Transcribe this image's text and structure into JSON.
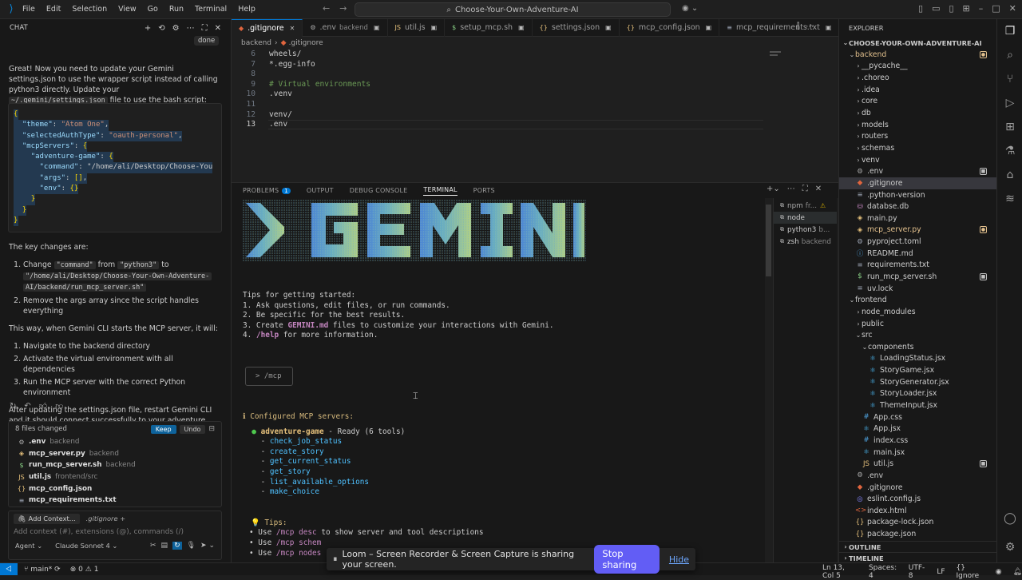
{
  "titlebar": {
    "menu": [
      "File",
      "Edit",
      "Selection",
      "View",
      "Go",
      "Run",
      "Terminal",
      "Help"
    ],
    "search": "Choose-Your-Own-Adventure-AI"
  },
  "chat": {
    "title": "CHAT",
    "done_label": "done",
    "intro": "Great! Now you need to update your Gemini settings.json to use the wrapper script instead of calling python3 directly. Update your",
    "intro_code": "~/.gemini/settings.json",
    "intro_end": " file to use the bash script:",
    "json_lines": [
      "{",
      "  \"theme\": \"Atom One\",",
      "  \"selectedAuthType\": \"oauth-personal\",",
      "  \"mcpServers\": {",
      "    \"adventure-game\": {",
      "      \"command\": \"/home/ali/Desktop/Choose-You",
      "      \"args\": [],",
      "      \"env\": {}",
      "    }",
      "  }",
      "}"
    ],
    "key_changes": "The key changes are:",
    "change1_a": "Change ",
    "change1_code1": "\"command\"",
    "change1_b": " from ",
    "change1_code2": "\"python3\"",
    "change1_c": " to",
    "change1_code3": "\"/home/ali/Desktop/Choose-Your-Own-Adventure-",
    "change1_code4": "AI/backend/run_mcp_server.sh\"",
    "change2": "Remove the args array since the script handles everything",
    "way": "This way, when Gemini CLI starts the MCP server, it will:",
    "steps": [
      "Navigate to the backend directory",
      "Activate the virtual environment with all dependencies",
      "Run the MCP server with the correct Python environment"
    ],
    "after": "After updating the settings.json file, restart Gemini CLI and it should connect successfully to your adventure game MCP server!",
    "files_changed": "8 files changed",
    "keep": "Keep",
    "undo": "Undo",
    "files": [
      {
        "icon": "gear",
        "name": ".env",
        "dir": "backend"
      },
      {
        "icon": "py",
        "name": "mcp_server.py",
        "dir": "backend"
      },
      {
        "icon": "$",
        "name": "run_mcp_server.sh",
        "dir": "backend"
      },
      {
        "icon": "JS",
        "name": "util.js",
        "dir": "frontend/src"
      },
      {
        "icon": "{}",
        "name": "mcp_config.json",
        "dir": ""
      },
      {
        "icon": "txt",
        "name": "mcp_requirements.txt",
        "dir": ""
      }
    ],
    "add_context": "Add Context...",
    "context_file": ".gitignore",
    "input_placeholder": "Add context (#), extensions (@), commands (/)",
    "mode": "Agent",
    "model": "Claude Sonnet 4"
  },
  "tabs": [
    {
      "label": ".gitignore",
      "dir": "",
      "active": true,
      "icon": "git"
    },
    {
      "label": ".env",
      "dir": "backend",
      "active": false,
      "icon": "gear"
    },
    {
      "label": "util.js",
      "dir": "",
      "active": false,
      "icon": "JS"
    },
    {
      "label": "setup_mcp.sh",
      "dir": "",
      "active": false,
      "icon": "$"
    },
    {
      "label": "settings.json",
      "dir": "",
      "active": false,
      "icon": "{}"
    },
    {
      "label": "mcp_config.json",
      "dir": "",
      "active": false,
      "icon": "{}"
    },
    {
      "label": "mcp_requirements.txt",
      "dir": "",
      "active": false,
      "icon": "txt"
    }
  ],
  "breadcrumb": [
    "backend",
    ".gitignore"
  ],
  "code": [
    {
      "n": "6",
      "text": "wheels/",
      "cls": "plain"
    },
    {
      "n": "7",
      "text": "*.egg-info",
      "cls": "plain"
    },
    {
      "n": "8",
      "text": "",
      "cls": "plain"
    },
    {
      "n": "9",
      "text": "# Virtual environments",
      "cls": "comment"
    },
    {
      "n": "10",
      "text": ".venv",
      "cls": "plain"
    },
    {
      "n": "11",
      "text": "",
      "cls": "plain"
    },
    {
      "n": "12",
      "text": "venv/",
      "cls": "plain"
    },
    {
      "n": "13",
      "text": ".env",
      "cls": "plain"
    }
  ],
  "panel_tabs": [
    {
      "label": "PROBLEMS",
      "badge": "1"
    },
    {
      "label": "OUTPUT",
      "badge": ""
    },
    {
      "label": "DEBUG CONSOLE",
      "badge": ""
    },
    {
      "label": "TERMINAL",
      "badge": "",
      "active": true
    },
    {
      "label": "PORTS",
      "badge": ""
    }
  ],
  "terminal": {
    "banner": "GEMINI",
    "tips_header": "Tips for getting started:",
    "tips": [
      "1. Ask questions, edit files, or run commands.",
      "2. Be specific for the best results."
    ],
    "tip3_a": "3. Create ",
    "tip3_b": "GEMINI.md",
    "tip3_c": " files to customize your interactions with Gemini.",
    "tip4_a": "4. ",
    "tip4_b": "/help",
    "tip4_c": " for more information.",
    "prompt": "> /mcp",
    "configured": "ℹ Configured MCP servers:",
    "server_name": "adventure-game",
    "server_status": " - Ready (6 tools)",
    "tools": [
      "check_job_status",
      "create_story",
      "get_current_status",
      "get_story",
      "list_available_options",
      "make_choice"
    ],
    "tips2_header": "💡 Tips:",
    "tips2": [
      {
        "a": "• Use ",
        "b": "/mcp desc",
        "c": " to show server and tool descriptions"
      },
      {
        "a": "• Use ",
        "b": "/mcp schem",
        "c": ""
      },
      {
        "a": "• Use ",
        "b": "/mcp nodes",
        "c": ""
      }
    ]
  },
  "terminal_list": [
    {
      "icon": ">_",
      "name": "npm",
      "extra": "fr...",
      "warn": true
    },
    {
      "icon": ">_",
      "name": "node",
      "extra": "",
      "active": true
    },
    {
      "icon": ">_",
      "name": "python3",
      "extra": "b..."
    },
    {
      "icon": ">_",
      "name": "zsh",
      "extra": "backend"
    }
  ],
  "explorer": {
    "title": "EXPLORER",
    "root": "CHOOSE-YOUR-OWN-ADVENTURE-AI",
    "items": [
      {
        "depth": 1,
        "type": "folder-open",
        "name": "backend",
        "color": "#e2c08d",
        "badge": "dot"
      },
      {
        "depth": 2,
        "type": "folder",
        "name": "__pycache__"
      },
      {
        "depth": 2,
        "type": "folder",
        "name": ".choreo"
      },
      {
        "depth": 2,
        "type": "folder",
        "name": ".idea"
      },
      {
        "depth": 2,
        "type": "folder",
        "name": "core"
      },
      {
        "depth": 2,
        "type": "folder",
        "name": "db"
      },
      {
        "depth": 2,
        "type": "folder",
        "name": "models"
      },
      {
        "depth": 2,
        "type": "folder",
        "name": "routers"
      },
      {
        "depth": 2,
        "type": "folder",
        "name": "schemas"
      },
      {
        "depth": 2,
        "type": "folder",
        "name": "venv"
      },
      {
        "depth": 2,
        "type": "gear",
        "name": ".env",
        "badge": "M"
      },
      {
        "depth": 2,
        "type": "git",
        "name": ".gitignore",
        "selected": true
      },
      {
        "depth": 2,
        "type": "file",
        "name": ".python-version"
      },
      {
        "depth": 2,
        "type": "db",
        "name": "databse.db"
      },
      {
        "depth": 2,
        "type": "py",
        "name": "main.py"
      },
      {
        "depth": 2,
        "type": "py",
        "name": "mcp_server.py",
        "color": "#e2c08d",
        "badge": "dot"
      },
      {
        "depth": 2,
        "type": "toml",
        "name": "pyproject.toml"
      },
      {
        "depth": 2,
        "type": "info",
        "name": "README.md"
      },
      {
        "depth": 2,
        "type": "txt",
        "name": "requirements.txt"
      },
      {
        "depth": 2,
        "type": "sh",
        "name": "run_mcp_server.sh",
        "badge": "M"
      },
      {
        "depth": 2,
        "type": "file",
        "name": "uv.lock"
      },
      {
        "depth": 1,
        "type": "folder-open",
        "name": "frontend"
      },
      {
        "depth": 2,
        "type": "folder",
        "name": "node_modules"
      },
      {
        "depth": 2,
        "type": "folder",
        "name": "public"
      },
      {
        "depth": 2,
        "type": "folder-open",
        "name": "src"
      },
      {
        "depth": 3,
        "type": "folder-open",
        "name": "components"
      },
      {
        "depth": 4,
        "type": "jsx",
        "name": "LoadingStatus.jsx"
      },
      {
        "depth": 4,
        "type": "jsx",
        "name": "StoryGame.jsx"
      },
      {
        "depth": 4,
        "type": "jsx",
        "name": "StoryGenerator.jsx"
      },
      {
        "depth": 4,
        "type": "jsx",
        "name": "StoryLoader.jsx"
      },
      {
        "depth": 4,
        "type": "jsx",
        "name": "ThemeInput.jsx"
      },
      {
        "depth": 3,
        "type": "css",
        "name": "App.css"
      },
      {
        "depth": 3,
        "type": "jsx",
        "name": "App.jsx"
      },
      {
        "depth": 3,
        "type": "css",
        "name": "index.css"
      },
      {
        "depth": 3,
        "type": "jsx",
        "name": "main.jsx"
      },
      {
        "depth": 3,
        "type": "js",
        "name": "util.js",
        "badge": "M"
      },
      {
        "depth": 2,
        "type": "gear",
        "name": ".env"
      },
      {
        "depth": 2,
        "type": "git",
        "name": ".gitignore"
      },
      {
        "depth": 2,
        "type": "eslint",
        "name": "eslint.config.js"
      },
      {
        "depth": 2,
        "type": "html",
        "name": "index.html"
      },
      {
        "depth": 2,
        "type": "json",
        "name": "package-lock.json"
      },
      {
        "depth": 2,
        "type": "json",
        "name": "package.json"
      }
    ],
    "outline": "OUTLINE",
    "timeline": "TIMELINE"
  },
  "status": {
    "branch": "main*",
    "errors": "0",
    "warnings": "1",
    "position": "Ln 13, Col 5",
    "spaces": "Spaces: 4",
    "encoding": "UTF-8",
    "eol": "LF",
    "language": "Ignore"
  },
  "loom": {
    "message": "Loom – Screen Recorder & Screen Capture is sharing your screen.",
    "stop": "Stop sharing",
    "hide": "Hide"
  }
}
